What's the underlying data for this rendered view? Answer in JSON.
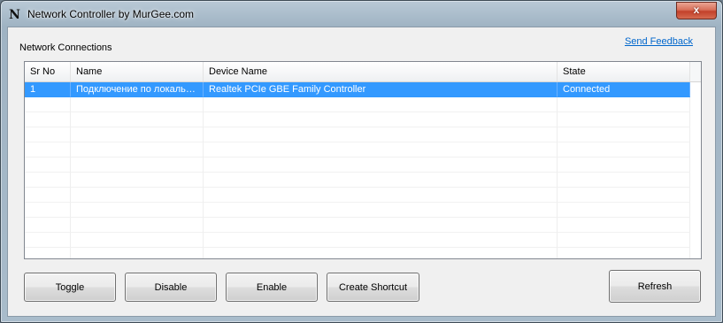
{
  "window": {
    "icon_letter": "N",
    "title": "Network Controller by MurGee.com",
    "close_glyph": "x"
  },
  "section": {
    "label": "Network Connections"
  },
  "links": {
    "send_feedback": "Send Feedback"
  },
  "table": {
    "columns": [
      "Sr No",
      "Name",
      "Device Name",
      "State"
    ],
    "rows": [
      {
        "sr_no": "1",
        "name": "Подключение по локаль…",
        "device": "Realtek PCIe GBE Family Controller",
        "state": "Connected",
        "selected": true
      }
    ]
  },
  "buttons": {
    "toggle": "Toggle",
    "disable": "Disable",
    "enable": "Enable",
    "create_shortcut": "Create Shortcut",
    "refresh": "Refresh"
  },
  "colors": {
    "selection": "#3399ff",
    "link": "#0066cc",
    "close_button": "#c2412a"
  }
}
